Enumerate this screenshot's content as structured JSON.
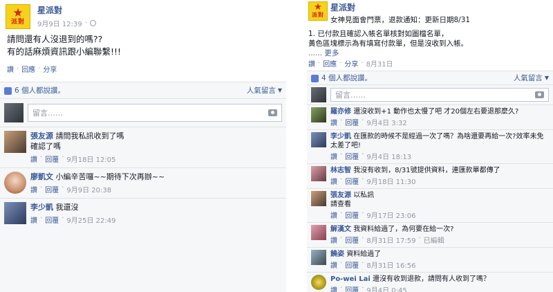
{
  "left": {
    "page_name": "星派對",
    "post_time": "9月9日 12:39",
    "logo_text": "派對",
    "body_lines": [
      "請問還有人沒退到的嗎??",
      "有的話麻煩資訊跟小編聯繫!!!"
    ],
    "actions": {
      "like": "讚",
      "comment": "回應",
      "share": "分享"
    },
    "likes_text": "6 個人都說讚。",
    "sort_label": "人氣留言",
    "comment_placeholder": "留言……",
    "comments": [
      {
        "name": "張友源",
        "text": "請問我私訊收到了嗎",
        "text2": "確認了嗎",
        "like": "讚",
        "reply": "回覆",
        "time": "9月18日 12:05"
      },
      {
        "name": "廖凱文",
        "text": "小編辛苦囉~~期待下次再辦~~",
        "text2": "",
        "like": "讚",
        "reply": "回覆",
        "time": "9月9日 20:38"
      },
      {
        "name": "李少凱",
        "text": "我還沒",
        "text2": "",
        "like": "讚",
        "reply": "回覆",
        "time": "9月25日 22:49"
      }
    ]
  },
  "right": {
    "page_name": "星派對",
    "logo_text": "派對",
    "title_line": "女神見面會門票，退款通知：更新日期8/31",
    "body_lines": [
      "1. 已付款且確認入帳名單核對如圖檔名單，",
      "黃色區塊標示為有填寫付款單，但是沒收到入帳。"
    ],
    "more_text": "...... 更多",
    "actions": {
      "like": "讚",
      "comment": "回應",
      "share": "分享",
      "time": "8月31日"
    },
    "likes_text": "4 個人都說讚。",
    "sort_label": "人氣留言",
    "comment_placeholder": "留言……",
    "comments": [
      {
        "name": "羅亦修",
        "text": "還沒收到+1 動作也太慢了吧 才20個左右要退那麼久?",
        "text2": "",
        "like": "讚",
        "reply": "回覆",
        "time": "9月4日 3:32",
        "extra": ""
      },
      {
        "name": "李少凱",
        "text": "在匯款的時候不是經過一次了嗎？為啥還要再給一次?效率未免",
        "text2": "太差了吧!",
        "like": "讚",
        "reply": "回覆",
        "time": "9月4日 18:13",
        "extra": ""
      },
      {
        "name": "林志智",
        "text": "我沒有收到，8/31號提供資料，連匯款單都傳了",
        "text2": "",
        "like": "讚",
        "reply": "回覆",
        "time": "9月18日 11:30",
        "extra": ""
      },
      {
        "name": "張友源",
        "text": "以私訊",
        "text2": "請查看",
        "like": "讚",
        "reply": "回覆",
        "time": "9月17日 23:06",
        "extra": ""
      },
      {
        "name": "解漢文",
        "text": "我資料給過了，為何要在給一次?",
        "text2": "",
        "like": "讚",
        "reply": "回覆",
        "time": "8月31日 17:59",
        "extra": "已編輯"
      },
      {
        "name": "饒姿",
        "text": "資料給過了",
        "text2": "",
        "like": "讚",
        "reply": "回覆",
        "time": "8月31日 16:56",
        "extra": ""
      },
      {
        "name": "Po-wei Lai",
        "text": "還沒有收到退款，請問有人收到了嗎？",
        "text2": "",
        "like": "讚",
        "reply": "回覆",
        "time": "9月4日 0:45",
        "extra": ""
      }
    ]
  }
}
